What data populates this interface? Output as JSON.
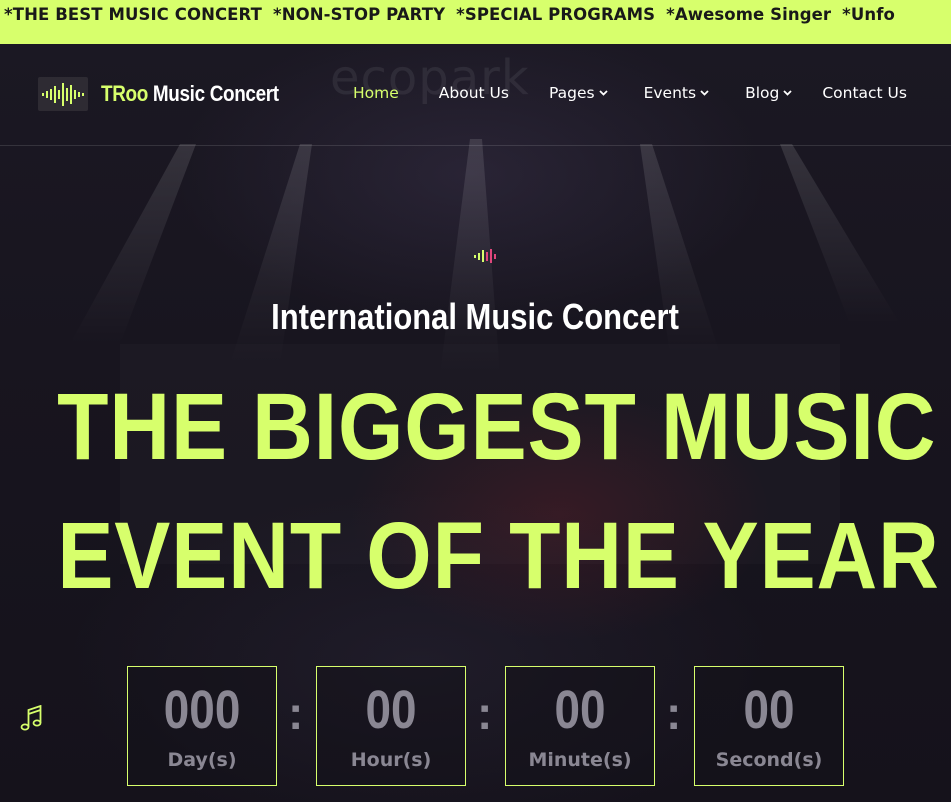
{
  "marquee": {
    "items": [
      "*THE BEST MUSIC CONCERT",
      "*NON-STOP PARTY",
      "*SPECIAL PROGRAMS",
      "*Awesome Singer",
      "*Unfo"
    ]
  },
  "header": {
    "logo": {
      "accent": "TRoo",
      "rest": " Music Concert"
    },
    "nav": [
      {
        "label": "Home",
        "active": true,
        "dropdown": false
      },
      {
        "label": "About Us",
        "active": false,
        "dropdown": false
      },
      {
        "label": "Pages",
        "active": false,
        "dropdown": true
      },
      {
        "label": "Events",
        "active": false,
        "dropdown": true
      },
      {
        "label": "Blog",
        "active": false,
        "dropdown": true
      },
      {
        "label": "Contact Us",
        "active": false,
        "dropdown": false
      }
    ]
  },
  "hero": {
    "background_brand": "ecopark",
    "subtitle": "International Music Concert",
    "headline_line1": "THE BIGGEST MUSIC",
    "headline_line2": "EVENT OF THE YEAR"
  },
  "countdown": {
    "separator": ":",
    "units": [
      {
        "value": "000",
        "label": "Day(s)"
      },
      {
        "value": "00",
        "label": "Hour(s)"
      },
      {
        "value": "00",
        "label": "Minute(s)"
      },
      {
        "value": "00",
        "label": "Second(s)"
      }
    ]
  },
  "icons": {
    "logo": "sound-wave-icon",
    "hero": "equalizer-icon",
    "floating": "music-note-icon",
    "caret": "chevron-down-icon"
  },
  "colors": {
    "accent": "#d7ff6c",
    "background": "#15121c",
    "countdown_text": "#8a8793",
    "equalizer_pink": "#e0467c"
  }
}
